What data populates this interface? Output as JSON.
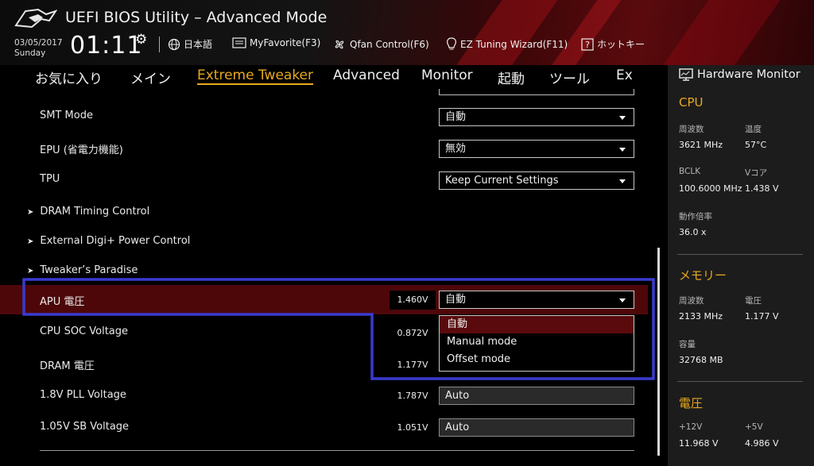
{
  "header": {
    "title": "UEFI BIOS Utility – Advanced Mode",
    "date": "03/05/2017",
    "day": "Sunday",
    "time": "01:11",
    "items": [
      {
        "icon": "globe-icon",
        "label": "日本語"
      },
      {
        "icon": "favorite-list-icon",
        "label": "MyFavorite(F3)"
      },
      {
        "icon": "fan-icon",
        "label": "Qfan Control(F6)"
      },
      {
        "icon": "lightbulb-icon",
        "label": "EZ Tuning Wizard(F11)"
      },
      {
        "icon": "help-icon",
        "label": "ホットキー"
      }
    ]
  },
  "tabs": [
    "お気に入り",
    "メイン",
    "Extreme Tweaker",
    "Advanced",
    "Monitor",
    "起動",
    "ツール",
    "Ex"
  ],
  "active_tab": "Extreme Tweaker",
  "settings": {
    "smt": {
      "label": "SMT Mode",
      "value": "自動"
    },
    "epu": {
      "label": "EPU (省電力機能)",
      "value": "無効"
    },
    "tpu": {
      "label": "TPU",
      "value": "Keep Current Settings"
    },
    "dram_timing": {
      "label": "DRAM Timing Control"
    },
    "digi_power": {
      "label": "External Digi+ Power Control"
    },
    "tweakers_paradise": {
      "label": "Tweaker’s Paradise"
    },
    "apu_voltage": {
      "label": "APU 電圧",
      "reading": "1.460V",
      "value": "自動"
    },
    "cpu_soc": {
      "label": "CPU SOC Voltage",
      "reading": "0.872V"
    },
    "dram_voltage": {
      "label": "DRAM 電圧",
      "reading": "1.177V"
    },
    "pll_18v": {
      "label": "1.8V PLL Voltage",
      "reading": "1.787V",
      "value": "Auto"
    },
    "sb_105v": {
      "label": "1.05V SB Voltage",
      "reading": "1.051V",
      "value": "Auto"
    }
  },
  "dropdown": {
    "options": [
      "自動",
      "Manual mode",
      "Offset mode"
    ],
    "selected": "自動"
  },
  "hardware_monitor": {
    "title": "Hardware Monitor",
    "cpu": {
      "heading": "CPU",
      "freq_label": "周波数",
      "freq": "3621 MHz",
      "temp_label": "温度",
      "temp": "57°C",
      "bclk_label": "BCLK",
      "bclk": "100.6000 MHz",
      "vcore_label": "Vコア",
      "vcore": "1.438 V",
      "ratio_label": "動作倍率",
      "ratio": "36.0 x"
    },
    "memory": {
      "heading": "メモリー",
      "freq_label": "周波数",
      "freq": "2133 MHz",
      "volt_label": "電圧",
      "volt": "1.177 V",
      "cap_label": "容量",
      "cap": "32768 MB"
    },
    "voltage": {
      "heading": "電圧",
      "v12_label": "+12V",
      "v12": "11.968 V",
      "v5_label": "+5V",
      "v5": "4.986 V"
    }
  },
  "colors": {
    "accent": "#e8a91e",
    "highlight_row": "#4d0709",
    "annotation": "#3a3ad0"
  }
}
